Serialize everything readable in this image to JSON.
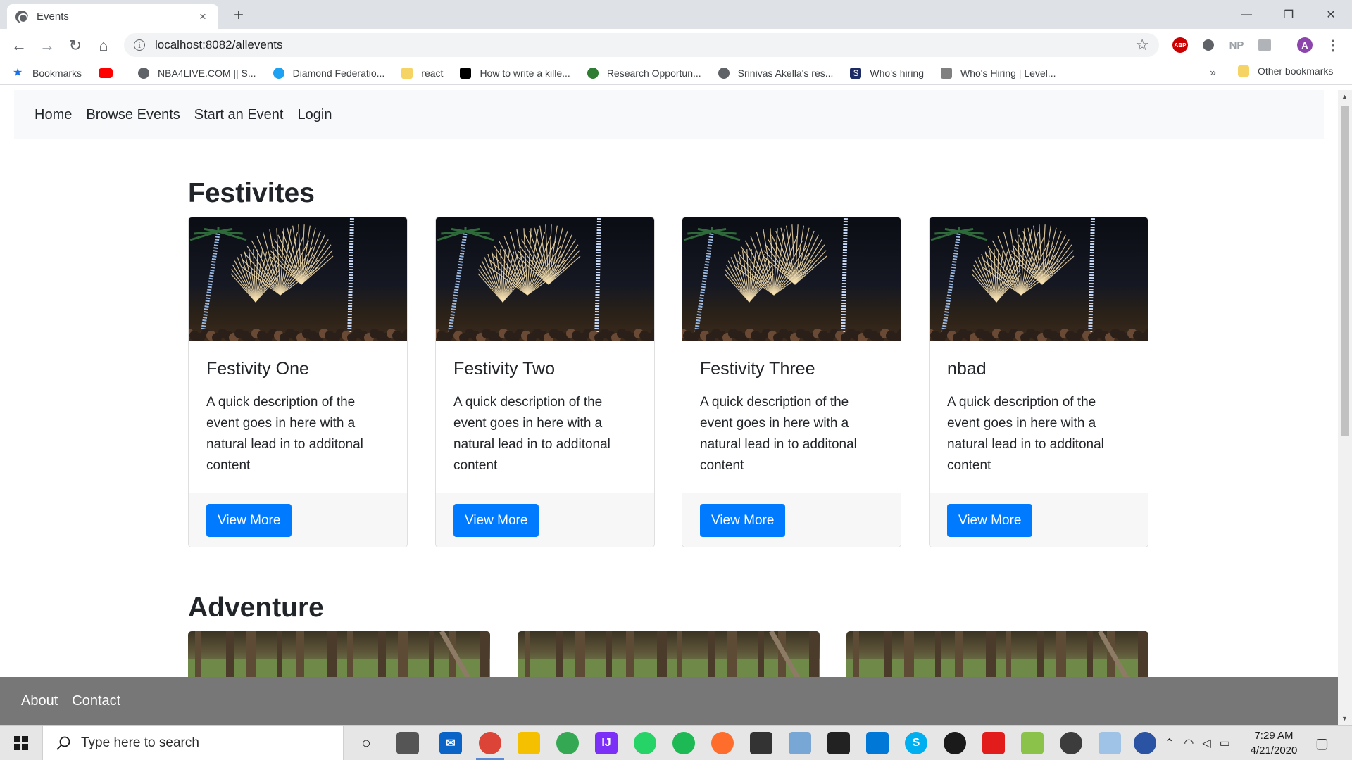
{
  "browser": {
    "tab_title": "Events",
    "tab_close": "×",
    "new_tab": "+",
    "url": "localhost:8082/allevents",
    "window_controls": {
      "minimize": "—",
      "restore": "❐",
      "close": "✕"
    },
    "nav": {
      "back": "←",
      "forward": "→",
      "reload": "↻",
      "home": "⌂"
    },
    "extensions": [
      "ABP",
      "NP",
      "A"
    ],
    "bookmarks": [
      {
        "label": "Bookmarks",
        "icon": "star-icon",
        "color": "#1a73e8"
      },
      {
        "label": "",
        "icon": "youtube-icon",
        "color": "#ff0000"
      },
      {
        "label": "NBA4LIVE.COM || S...",
        "icon": "globe-icon",
        "color": "#5f6368"
      },
      {
        "label": "Diamond Federatio...",
        "icon": "edge-icon",
        "color": "#1da1f2"
      },
      {
        "label": "react",
        "icon": "folder-icon",
        "color": "#f6d365"
      },
      {
        "label": "How to write a kille...",
        "icon": "code-icon",
        "color": "#000000"
      },
      {
        "label": "Research Opportun...",
        "icon": "leaf-icon",
        "color": "#2e7d32"
      },
      {
        "label": "Srinivas Akella's res...",
        "icon": "globe-icon",
        "color": "#5f6368"
      },
      {
        "label": "Who's hiring",
        "icon": "dollar-icon",
        "color": "#1d2b64"
      },
      {
        "label": "Who's Hiring | Level...",
        "icon": "chart-icon",
        "color": "#808080"
      }
    ],
    "bookmarks_more": "»",
    "other_bookmarks": "Other bookmarks"
  },
  "site": {
    "nav": [
      "Home",
      "Browse Events",
      "Start an Event",
      "Login"
    ],
    "sections": [
      {
        "title": "Festivites",
        "cards": [
          {
            "title": "Festivity One",
            "text": "A quick description of the event goes in here with a natural lead in to additonal content",
            "button": "View More"
          },
          {
            "title": "Festivity Two",
            "text": "A quick description of the event goes in here with a natural lead in to additonal content",
            "button": "View More"
          },
          {
            "title": "Festivity Three",
            "text": "A quick description of the event goes in here with a natural lead in to additonal content",
            "button": "View More"
          },
          {
            "title": "nbad",
            "text": "A quick description of the event goes in here with a natural lead in to additonal content",
            "button": "View More"
          }
        ]
      },
      {
        "title": "Adventure",
        "cards": []
      }
    ],
    "footer": [
      "About",
      "Contact"
    ]
  },
  "taskbar": {
    "search_placeholder": "Type here to search",
    "time": "7:29 AM",
    "date": "4/21/2020"
  },
  "colors": {
    "primary": "#007bff",
    "footer_bg": "#777777",
    "nav_bg": "#f8f9fa"
  }
}
